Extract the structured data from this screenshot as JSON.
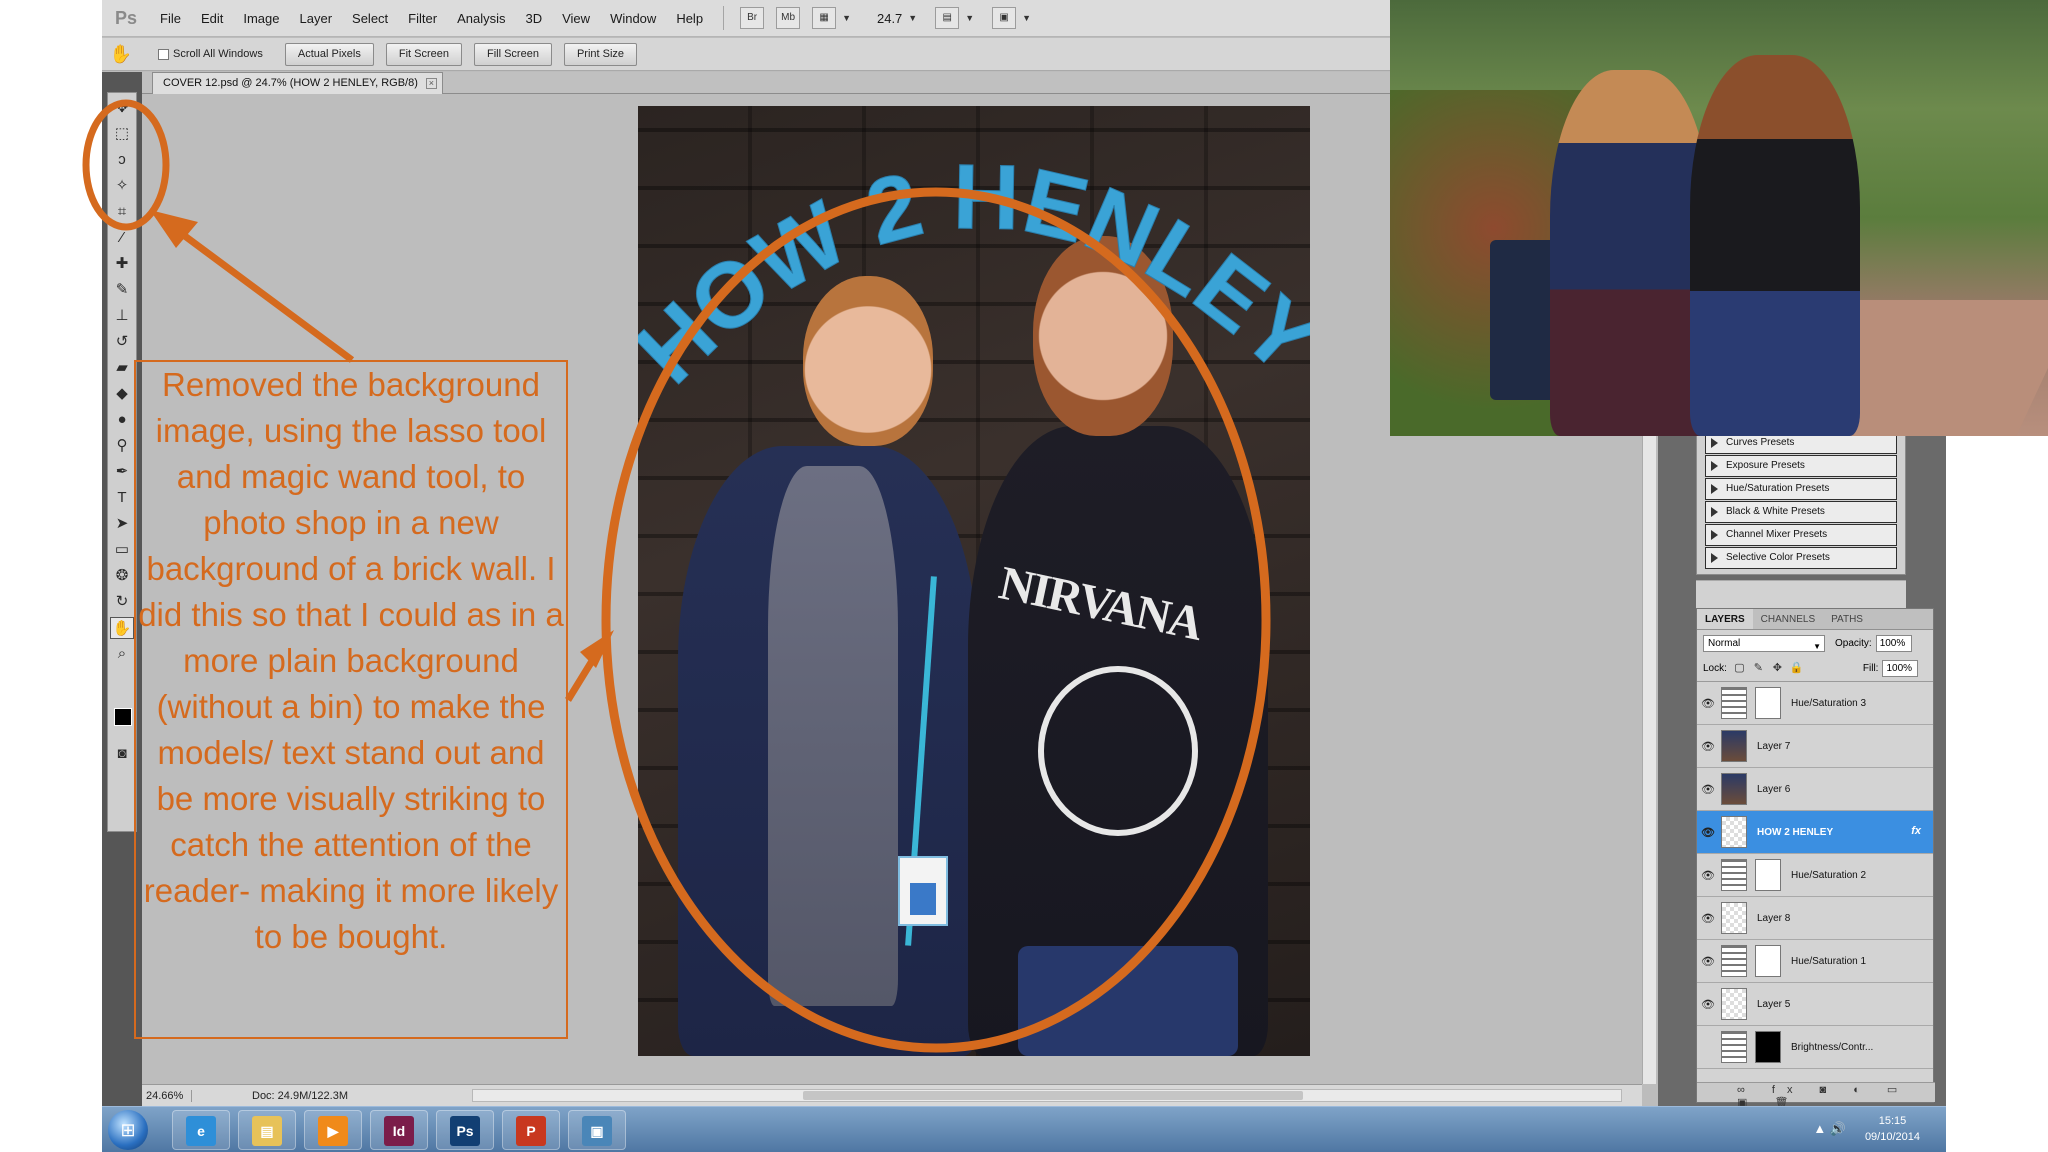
{
  "app": {
    "logo": "Ps",
    "menu": [
      "File",
      "Edit",
      "Image",
      "Layer",
      "Select",
      "Filter",
      "Analysis",
      "3D",
      "View",
      "Window",
      "Help"
    ],
    "bridge_btn": "Br",
    "minibridge_btn": "Mb",
    "zoom_value": "24.7"
  },
  "options_bar": {
    "scroll_all_label": "Scroll All Windows",
    "actual_pixels": "Actual Pixels",
    "fit_screen": "Fit Screen",
    "fill_screen": "Fill Screen",
    "print_size": "Print Size"
  },
  "document": {
    "tab_title": "COVER 12.psd @ 24.7% (HOW 2 HENLEY, RGB/8)",
    "cover_title": "HOW 2 HENLEY",
    "shirt_text": "NIRVANA"
  },
  "status": {
    "zoom": "24.66%",
    "doc_size": "Doc: 24.9M/122.3M"
  },
  "adjustment_presets": [
    "Curves Presets",
    "Exposure Presets",
    "Hue/Saturation Presets",
    "Black & White Presets",
    "Channel Mixer Presets",
    "Selective Color Presets"
  ],
  "layers_panel": {
    "tabs": [
      "LAYERS",
      "CHANNELS",
      "PATHS"
    ],
    "blend_mode": "Normal",
    "opacity_label": "Opacity:",
    "opacity_value": "100%",
    "lock_label": "Lock:",
    "fill_label": "Fill:",
    "fill_value": "100%",
    "layers": [
      {
        "name": "Hue/Saturation 3",
        "thumb": "adj",
        "mask": "white",
        "selected": false
      },
      {
        "name": "Layer 7",
        "thumb": "photo",
        "mask": "",
        "selected": false
      },
      {
        "name": "Layer 6",
        "thumb": "photo",
        "mask": "",
        "selected": false
      },
      {
        "name": "HOW 2 HENLEY",
        "thumb": "checker",
        "mask": "",
        "selected": true,
        "fx": "fx"
      },
      {
        "name": "Hue/Saturation 2",
        "thumb": "adj",
        "mask": "white",
        "selected": false
      },
      {
        "name": "Layer 8",
        "thumb": "checker",
        "mask": "",
        "selected": false
      },
      {
        "name": "Hue/Saturation 1",
        "thumb": "adj",
        "mask": "white",
        "selected": false
      },
      {
        "name": "Layer 5",
        "thumb": "checker",
        "mask": "",
        "selected": false
      },
      {
        "name": "Brightness/Contr...",
        "thumb": "adj",
        "mask": "black",
        "selected": false
      }
    ]
  },
  "annotation": {
    "text": "Removed the background image, using the lasso tool and magic wand tool, to photo shop in a new background of a brick wall. I did this so that I could as in a more plain background (without a bin) to make the models/ text stand out and be more visually striking to catch the attention of the reader- making it more likely to be bought.",
    "color": "#d56a1e"
  },
  "taskbar": {
    "apps": [
      "IE",
      "Explorer",
      "Media",
      "Id",
      "Ps",
      "P",
      "Photos"
    ],
    "time": "15:15",
    "date": "09/10/2014"
  },
  "colors": {
    "title_blue": "#3aa3d6",
    "selected_layer": "#3b8fe1",
    "orange": "#d56a1e"
  }
}
